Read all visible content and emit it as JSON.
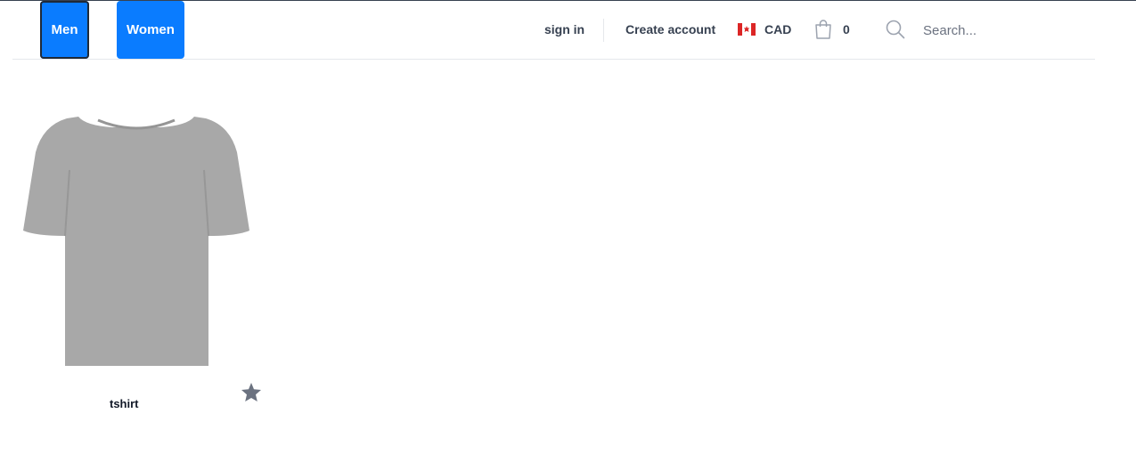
{
  "categories": [
    {
      "label": "Men"
    },
    {
      "label": "Women"
    }
  ],
  "nav": {
    "signin": "sign in",
    "create_account": "Create account",
    "currency": "CAD",
    "cart_count": "0"
  },
  "search": {
    "placeholder": "Search...",
    "value": ""
  },
  "products": [
    {
      "name": "tshirt"
    }
  ],
  "colors": {
    "accent": "#0a7cff",
    "text": "#374151",
    "divider": "#e5e7eb",
    "star": "#6b7280"
  },
  "icons": [
    "canada-flag-icon",
    "shopping-bag-icon",
    "search-icon",
    "star-icon"
  ]
}
